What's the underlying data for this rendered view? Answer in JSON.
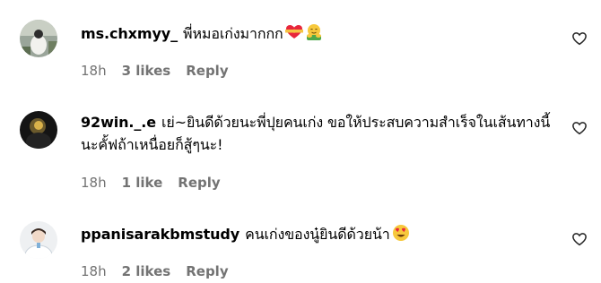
{
  "comments": [
    {
      "username": "ms.chxmyy_",
      "text": "พี่หมอเก่งมากกก",
      "emojis": [
        "heart-ribbon-emoji",
        "hugging-face-emoji"
      ],
      "time": "18h",
      "likes": "3 likes",
      "reply": "Reply",
      "avatar": "avatar-ms-chxmyy"
    },
    {
      "username": "92win._.e",
      "text": "เย่~ยินดีด้วยนะพี่ปุยคนเก่ง ขอให้ประสบความสำเร็จในเส้นทางนี้นะคั้ฟถ้าเหนื่อยก็สู้ๆนะ!",
      "emojis": [],
      "time": "18h",
      "likes": "1 like",
      "reply": "Reply",
      "avatar": "avatar-92win"
    },
    {
      "username": "ppanisarakbmstudy",
      "text": "คนเก่งของนู๋ยินดีด้วยน้า",
      "emojis": [
        "heart-eyes-emoji"
      ],
      "time": "18h",
      "likes": "2 likes",
      "reply": "Reply",
      "avatar": "avatar-ppanisarakbmstudy"
    }
  ],
  "colors": {
    "meta_text": "#737373",
    "primary_text": "#000000",
    "background": "#ffffff"
  }
}
